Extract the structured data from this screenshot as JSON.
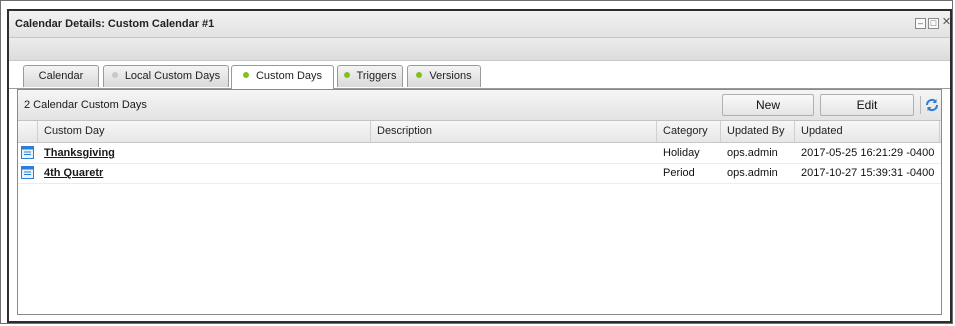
{
  "window": {
    "title": "Calendar Details: Custom Calendar #1"
  },
  "tabs": [
    {
      "label": "Calendar",
      "dot": null
    },
    {
      "label": "Local Custom Days",
      "dot": "#c8c8c8"
    },
    {
      "label": "Custom Days",
      "dot": "#7dc31c",
      "active": true
    },
    {
      "label": "Triggers",
      "dot": "#7dc31c"
    },
    {
      "label": "Versions",
      "dot": "#7dc31c"
    }
  ],
  "panel": {
    "count_label": "2 Calendar Custom Days",
    "new_label": "New",
    "edit_label": "Edit"
  },
  "columns": [
    "Custom Day",
    "Description",
    "Category",
    "Updated By",
    "Updated"
  ],
  "rows": [
    {
      "custom_day": "Thanksgiving",
      "description": "",
      "category": "Holiday",
      "updated_by": "ops.admin",
      "updated": "2017-05-25 16:21:29 -0400"
    },
    {
      "custom_day": "4th Quaretr",
      "description": "",
      "category": "Period",
      "updated_by": "ops.admin",
      "updated": "2017-10-27 15:39:31 -0400"
    }
  ],
  "colors": {
    "active_dot": "#7dc31c",
    "inactive_dot": "#c8c8c8",
    "accent_icon": "#2b7fd6"
  }
}
